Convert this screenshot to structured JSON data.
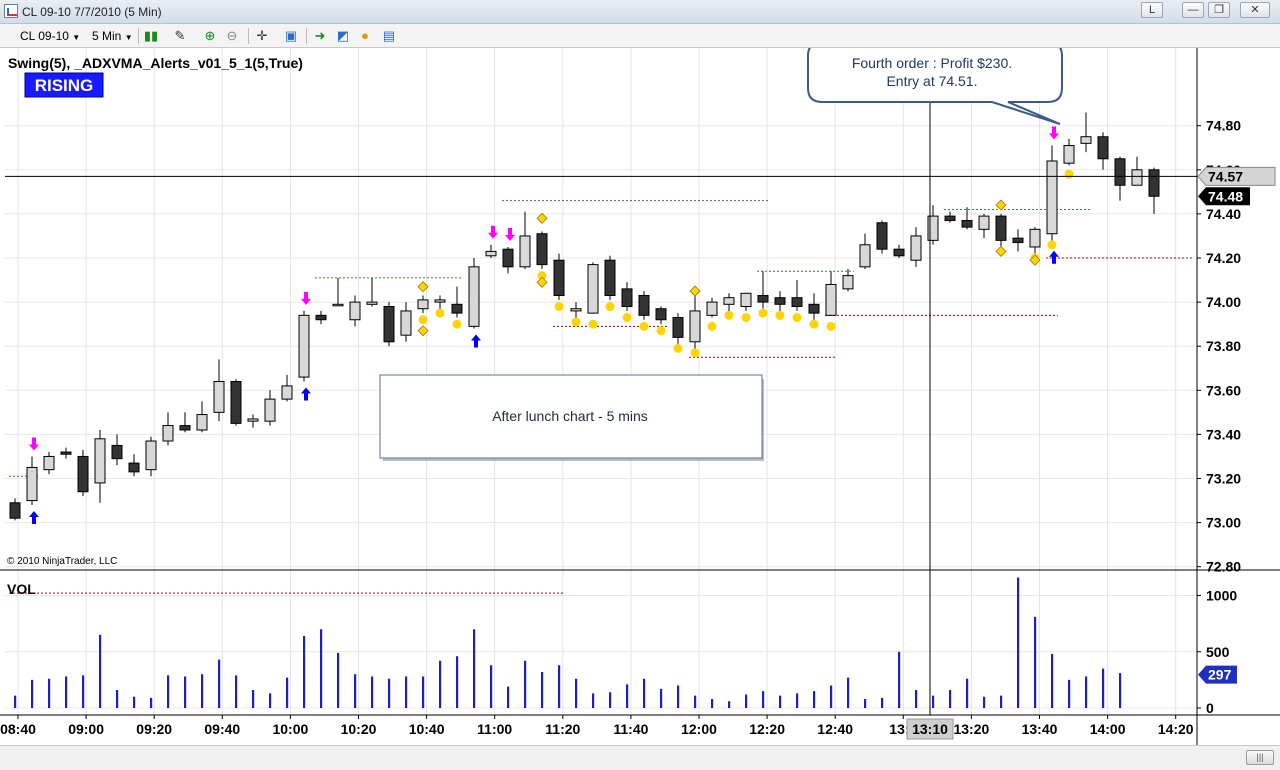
{
  "window": {
    "title": "CL 09-10  7/7/2010 (5 Min)",
    "btn_l": "L",
    "btn_min": "—",
    "btn_max": "❐",
    "btn_close": "✕"
  },
  "toolbar": {
    "instrument": "CL 09-10",
    "interval": "5 Min"
  },
  "chart": {
    "indicator_label": "Swing(5),  _ADXVMA_Alerts_v01_5_1(5,True)",
    "trend_badge": "RISING",
    "copyright": "© 2010 NinjaTrader, LLC",
    "volume_label": "VOL",
    "callout_line1": "Fourth order : Profit $230.",
    "callout_line2": "Entry at 74.51.",
    "note_box": "After lunch chart - 5 mins",
    "price_tag_top": "74.57",
    "price_tag_last": "74.48",
    "volume_tag": "297",
    "crosshair_time": "13:10",
    "colors": {
      "down_candle": "#333333",
      "up_candle": "#d8d8d8",
      "volume_bar": "#1f1fbf",
      "buy_arrow": "#0000ff",
      "sell_arrow": "#ff00ff",
      "adxvma_dot": "#ffd400",
      "resistance_line": "#2a8a2a",
      "support_line": "#b00000",
      "badge_bg": "#1a1aff"
    }
  },
  "chart_data": [
    {
      "type": "candlestick",
      "title": "",
      "ylim": [
        72.62,
        74.92
      ],
      "y_ticks": [
        "74.80",
        "74.60",
        "74.40",
        "74.20",
        "74.00",
        "73.80",
        "73.60",
        "73.40",
        "73.20",
        "73.00",
        "72.80"
      ],
      "x_ticks": [
        "08:40",
        "09:00",
        "09:20",
        "09:40",
        "10:00",
        "10:20",
        "10:40",
        "11:00",
        "11:20",
        "11:40",
        "12:00",
        "12:20",
        "12:40",
        "13:0",
        "13:20",
        "13:40",
        "14:00",
        "14:20"
      ],
      "candles": [
        [
          73.09,
          73.02,
          73.11,
          73.01
        ],
        [
          73.1,
          73.25,
          73.3,
          73.08
        ],
        [
          73.24,
          73.3,
          73.32,
          73.22
        ],
        [
          73.32,
          73.31,
          73.34,
          73.29
        ],
        [
          73.3,
          73.14,
          73.33,
          73.12
        ],
        [
          73.18,
          73.38,
          73.42,
          73.09
        ],
        [
          73.35,
          73.29,
          73.4,
          73.26
        ],
        [
          73.27,
          73.23,
          73.31,
          73.21
        ],
        [
          73.24,
          73.37,
          73.39,
          73.21
        ],
        [
          73.37,
          73.44,
          73.5,
          73.35
        ],
        [
          73.44,
          73.42,
          73.5,
          73.41
        ],
        [
          73.42,
          73.49,
          73.55,
          73.41
        ],
        [
          73.5,
          73.64,
          73.74,
          73.46
        ],
        [
          73.64,
          73.45,
          73.65,
          73.44
        ],
        [
          73.46,
          73.47,
          73.49,
          73.43
        ],
        [
          73.46,
          73.56,
          73.6,
          73.44
        ],
        [
          73.56,
          73.62,
          73.67,
          73.55
        ],
        [
          73.66,
          73.94,
          73.96,
          73.64
        ],
        [
          73.94,
          73.92,
          73.96,
          73.9
        ],
        [
          73.99,
          73.99,
          74.11,
          73.98
        ],
        [
          73.92,
          74.0,
          74.03,
          73.89
        ],
        [
          73.99,
          74.0,
          74.11,
          73.98
        ],
        [
          73.98,
          73.82,
          74.0,
          73.8
        ],
        [
          73.85,
          73.96,
          74.0,
          73.82
        ],
        [
          73.97,
          74.01,
          74.03,
          73.95
        ],
        [
          74.0,
          74.01,
          74.03,
          73.96
        ],
        [
          73.99,
          73.95,
          74.07,
          73.93
        ],
        [
          73.89,
          74.16,
          74.2,
          73.88
        ],
        [
          74.21,
          74.23,
          74.26,
          74.2
        ],
        [
          74.24,
          74.16,
          74.25,
          74.13
        ],
        [
          74.16,
          74.3,
          74.41,
          74.15
        ],
        [
          74.31,
          74.17,
          74.32,
          74.15
        ],
        [
          74.19,
          74.03,
          74.22,
          74.01
        ],
        [
          73.96,
          73.97,
          74.0,
          73.92
        ],
        [
          73.95,
          74.17,
          74.18,
          73.95
        ],
        [
          74.19,
          74.03,
          74.21,
          74.01
        ],
        [
          74.06,
          73.98,
          74.09,
          73.96
        ],
        [
          74.03,
          73.94,
          74.05,
          73.92
        ],
        [
          73.97,
          73.92,
          73.98,
          73.9
        ],
        [
          73.93,
          73.84,
          73.95,
          73.78
        ],
        [
          73.82,
          73.96,
          74.07,
          73.76
        ],
        [
          73.94,
          74.0,
          74.02,
          73.93
        ],
        [
          73.99,
          74.02,
          74.04,
          73.94
        ],
        [
          73.98,
          74.04,
          74.04,
          73.96
        ],
        [
          74.03,
          74.0,
          74.14,
          73.97
        ],
        [
          74.02,
          73.99,
          74.05,
          73.95
        ],
        [
          74.02,
          73.98,
          74.1,
          73.96
        ],
        [
          73.99,
          73.95,
          74.04,
          73.92
        ],
        [
          73.94,
          74.08,
          74.14,
          73.94
        ],
        [
          74.06,
          74.12,
          74.15,
          74.05
        ],
        [
          74.16,
          74.26,
          74.31,
          74.15
        ],
        [
          74.36,
          74.24,
          74.37,
          74.22
        ],
        [
          74.24,
          74.21,
          74.26,
          74.2
        ],
        [
          74.19,
          74.3,
          74.34,
          74.16
        ],
        [
          74.28,
          74.39,
          74.44,
          74.26
        ],
        [
          74.39,
          74.37,
          74.41,
          74.36
        ],
        [
          74.37,
          74.34,
          74.43,
          74.33
        ],
        [
          74.33,
          74.39,
          74.4,
          74.29
        ],
        [
          74.39,
          74.28,
          74.4,
          74.24
        ],
        [
          74.29,
          74.27,
          74.33,
          74.23
        ],
        [
          74.25,
          74.33,
          74.34,
          74.22
        ],
        [
          74.31,
          74.64,
          74.71,
          74.26
        ],
        [
          74.63,
          74.71,
          74.74,
          74.62
        ],
        [
          74.72,
          74.75,
          74.86,
          74.68
        ],
        [
          74.75,
          74.65,
          74.77,
          74.6
        ],
        [
          74.65,
          74.53,
          74.66,
          74.46
        ],
        [
          74.53,
          74.6,
          74.66,
          74.54
        ],
        [
          74.6,
          74.48,
          74.61,
          74.4
        ]
      ],
      "buy_arrows": [
        1,
        17,
        27,
        61
      ],
      "sell_arrows": [
        1,
        17,
        28,
        29,
        61
      ],
      "adxvma_dots": [
        24,
        25,
        26,
        31,
        32,
        33,
        34,
        35,
        36,
        37,
        38,
        39,
        40,
        41,
        42,
        43,
        44,
        45,
        46,
        47,
        48,
        60,
        61,
        62
      ],
      "resistance_lines": [
        [
          74.11,
          18,
          26
        ],
        [
          74.46,
          29,
          44
        ],
        [
          74.14,
          44,
          49
        ],
        [
          74.42,
          55,
          63
        ],
        [
          73.21,
          0,
          1
        ]
      ],
      "support_lines": [
        [
          73.89,
          32,
          38
        ],
        [
          73.75,
          40,
          48
        ],
        [
          73.94,
          48,
          61
        ],
        [
          74.2,
          61,
          69
        ],
        [
          72.68,
          0,
          32
        ]
      ],
      "last_price": 74.48,
      "marked_price": 74.57
    },
    {
      "type": "bar",
      "title": "",
      "ylabel": "VOL",
      "ylim": [
        0,
        1200
      ],
      "y_ticks": [
        "1000",
        "500",
        "0"
      ],
      "values": [
        110,
        250,
        260,
        280,
        290,
        650,
        160,
        100,
        90,
        290,
        280,
        300,
        430,
        290,
        160,
        130,
        270,
        640,
        700,
        490,
        300,
        280,
        260,
        280,
        280,
        420,
        460,
        700,
        380,
        190,
        420,
        320,
        380,
        260,
        130,
        140,
        210,
        260,
        170,
        200,
        110,
        80,
        60,
        120,
        150,
        110,
        130,
        150,
        200,
        270,
        80,
        90,
        500,
        160,
        110,
        160,
        260,
        100,
        110,
        1160,
        810,
        480,
        250,
        280,
        350,
        310
      ],
      "last_volume": 297
    }
  ]
}
